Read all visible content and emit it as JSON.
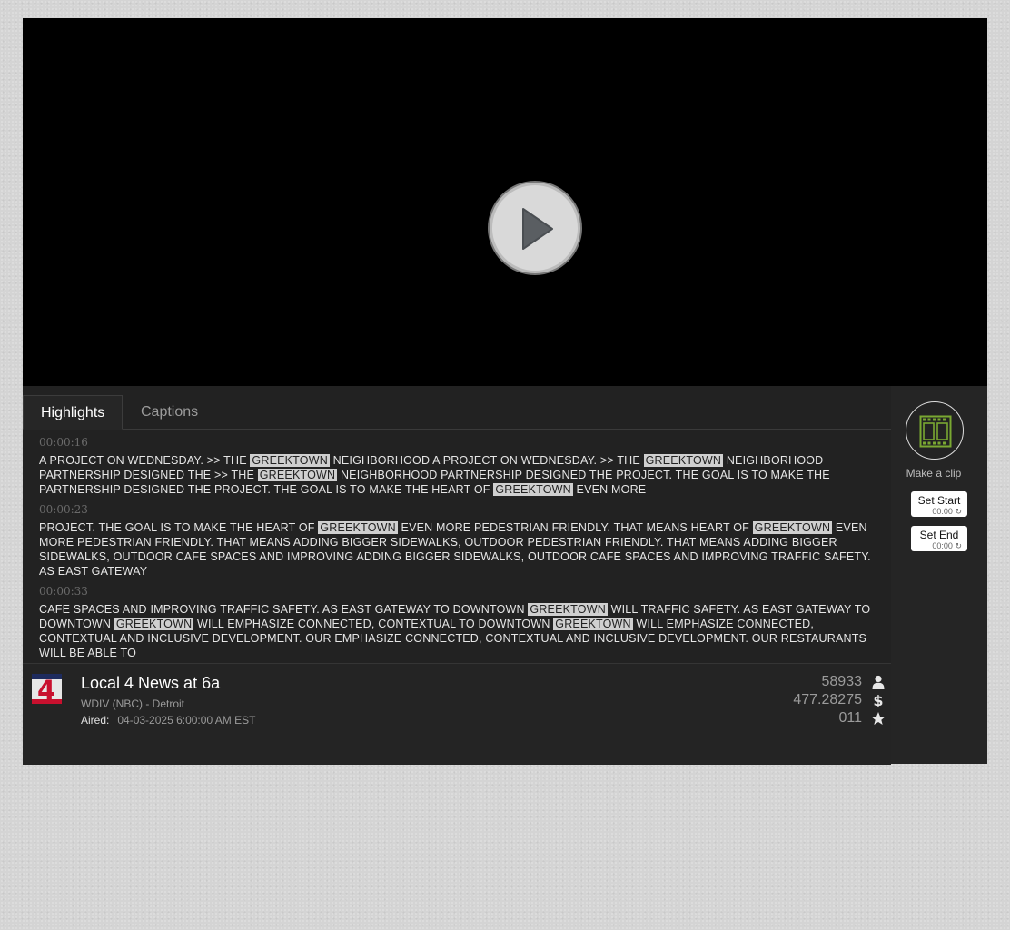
{
  "player": {
    "play_label": "Play"
  },
  "tabs": [
    {
      "label": "Highlights",
      "active": true
    },
    {
      "label": "Captions",
      "active": false
    }
  ],
  "highlights": [
    {
      "time": "00:00:16",
      "segments": [
        {
          "t": "A PROJECT ON WEDNESDAY. >> THE "
        },
        {
          "t": "GREEKTOWN",
          "hl": true
        },
        {
          "t": " NEIGHBORHOOD A PROJECT ON WEDNESDAY. >> THE "
        },
        {
          "t": "GREEKTOWN",
          "hl": true
        },
        {
          "t": " NEIGHBORHOOD PARTNERSHIP DESIGNED THE >> THE "
        },
        {
          "t": "GREEKTOWN",
          "hl": true
        },
        {
          "t": " NEIGHBORHOOD PARTNERSHIP DESIGNED THE PROJECT. THE GOAL IS TO MAKE THE PARTNERSHIP DESIGNED THE PROJECT. THE GOAL IS TO MAKE THE HEART OF "
        },
        {
          "t": "GREEKTOWN",
          "hl": true
        },
        {
          "t": " EVEN MORE"
        }
      ]
    },
    {
      "time": "00:00:23",
      "segments": [
        {
          "t": "PROJECT. THE GOAL IS TO MAKE THE HEART OF "
        },
        {
          "t": "GREEKTOWN",
          "hl": true
        },
        {
          "t": " EVEN MORE PEDESTRIAN FRIENDLY. THAT MEANS HEART OF "
        },
        {
          "t": "GREEKTOWN",
          "hl": true
        },
        {
          "t": " EVEN MORE PEDESTRIAN FRIENDLY. THAT MEANS ADDING BIGGER SIDEWALKS, OUTDOOR PEDESTRIAN FRIENDLY. THAT MEANS ADDING BIGGER SIDEWALKS, OUTDOOR CAFE SPACES AND IMPROVING ADDING BIGGER SIDEWALKS, OUTDOOR CAFE SPACES AND IMPROVING TRAFFIC SAFETY. AS EAST GATEWAY"
        }
      ]
    },
    {
      "time": "00:00:33",
      "segments": [
        {
          "t": "CAFE SPACES AND IMPROVING TRAFFIC SAFETY. AS EAST GATEWAY TO DOWNTOWN "
        },
        {
          "t": "GREEKTOWN",
          "hl": true
        },
        {
          "t": " WILL TRAFFIC SAFETY. AS EAST GATEWAY TO DOWNTOWN "
        },
        {
          "t": "GREEKTOWN",
          "hl": true
        },
        {
          "t": " WILL EMPHASIZE CONNECTED, CONTEXTUAL TO DOWNTOWN "
        },
        {
          "t": "GREEKTOWN",
          "hl": true
        },
        {
          "t": " WILL EMPHASIZE CONNECTED, CONTEXTUAL AND INCLUSIVE DEVELOPMENT. OUR EMPHASIZE CONNECTED, CONTEXTUAL AND INCLUSIVE DEVELOPMENT. OUR RESTAURANTS WILL BE ABLE TO"
        }
      ]
    }
  ],
  "show": {
    "title": "Local 4 News at 6a",
    "station": "WDIV (NBC) - Detroit",
    "aired_label": "Aired:",
    "aired_value": "04-03-2025 6:00:00 AM EST",
    "logo_text": "4",
    "stats": [
      {
        "value": "58933",
        "icon": "person-icon"
      },
      {
        "value": "477.28275",
        "icon": "dollar-icon"
      },
      {
        "value": "011",
        "icon": "star-icon"
      }
    ]
  },
  "clip": {
    "make_label": "Make a clip",
    "set_start_label": "Set Start",
    "set_start_time": "00:00",
    "set_end_label": "Set End",
    "set_end_time": "00:00"
  }
}
